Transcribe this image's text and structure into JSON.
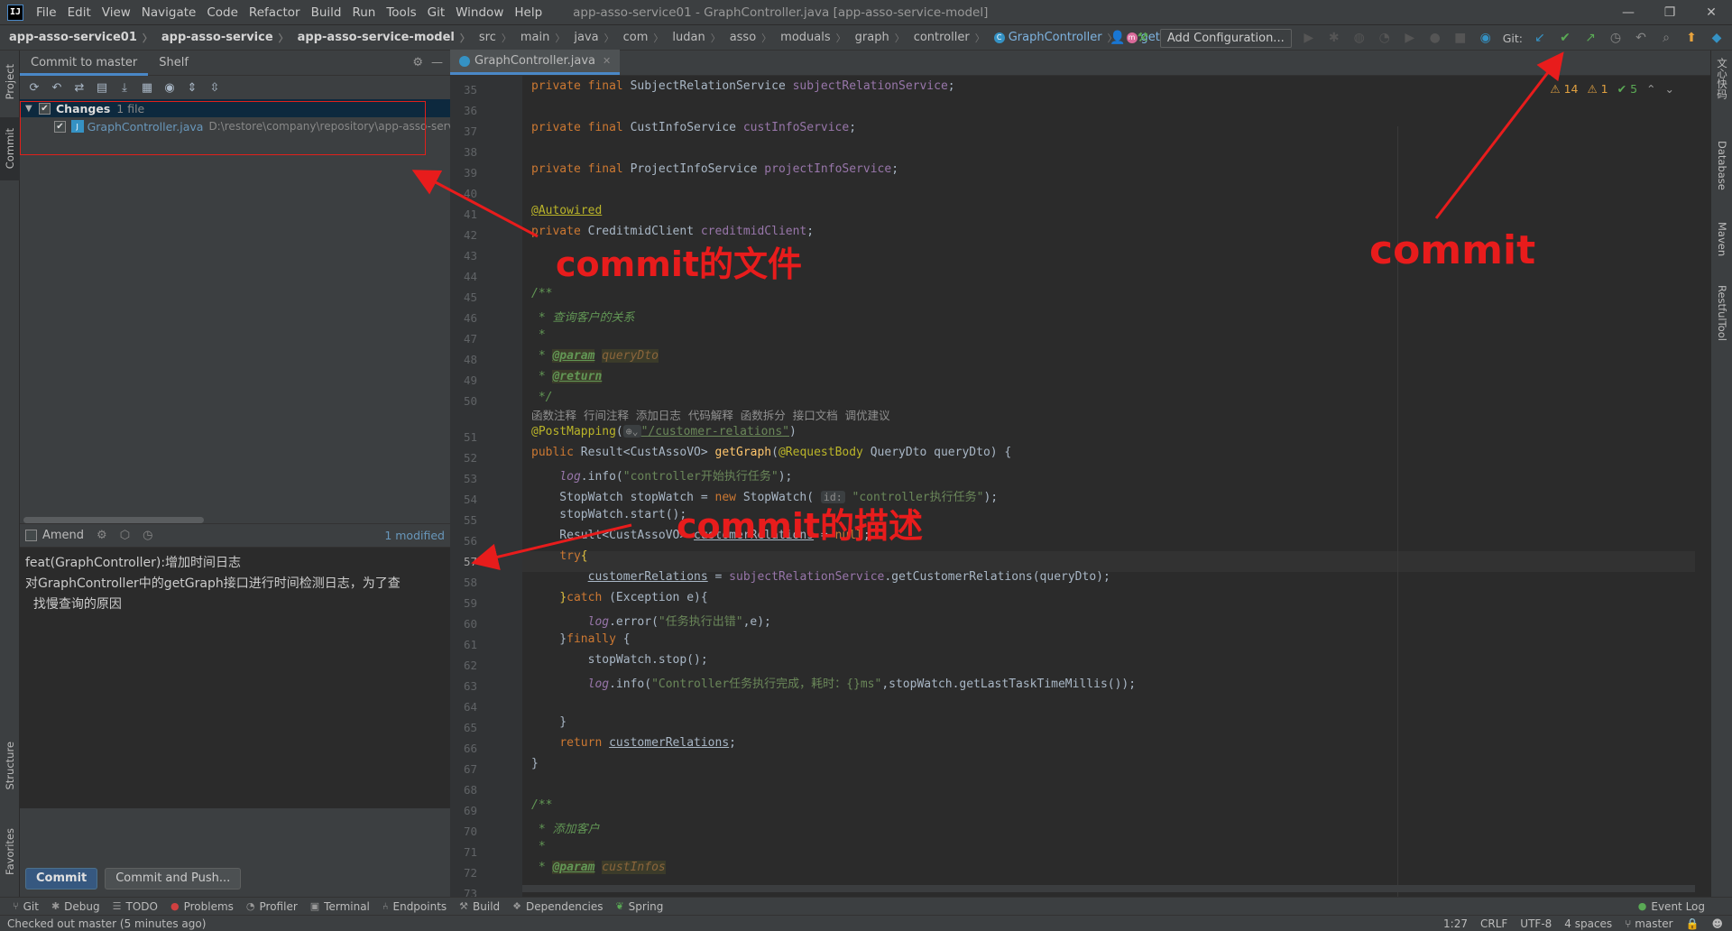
{
  "menu": {
    "items": [
      "File",
      "Edit",
      "View",
      "Navigate",
      "Code",
      "Refactor",
      "Build",
      "Run",
      "Tools",
      "Git",
      "Window",
      "Help"
    ],
    "window_title": "app-asso-service01 - GraphController.java [app-asso-service-model]"
  },
  "nav": {
    "breadcrumbs": [
      "app-asso-service01",
      "app-asso-service",
      "app-asso-service-model",
      "src",
      "main",
      "java",
      "com",
      "ludan",
      "asso",
      "moduals",
      "graph",
      "controller",
      "GraphController",
      "getGraph"
    ],
    "add_config": "Add Configuration...",
    "git_label": "Git:"
  },
  "left_tabs": {
    "project": "Project",
    "commit": "Commit",
    "structure": "Structure",
    "favorites": "Favorites"
  },
  "commit_panel": {
    "tab_commit": "Commit to master",
    "tab_shelf": "Shelf",
    "changes_label": "Changes",
    "changes_count": "1 file",
    "file_name": "GraphController.java",
    "file_path": "D:\\restore\\company\\repository\\app-asso-serv",
    "amend_label": "Amend",
    "modified": "1 modified",
    "message_lines": [
      "feat(GraphController):增加时间日志",
      "对GraphController中的getGraph接口进行时间检测日志，为了查",
      "  找慢查询的原因"
    ],
    "commit_button": "Commit",
    "commit_push_button": "Commit and Push..."
  },
  "editor": {
    "tab": "GraphController.java",
    "inspections": {
      "warnings": "14",
      "weak": "1",
      "ok": "5"
    },
    "line_numbers": [
      "35",
      "36",
      "37",
      "38",
      "39",
      "40",
      "41",
      "42",
      "43",
      "44",
      "45",
      "46",
      "47",
      "48",
      "49",
      "50",
      "51",
      "52",
      "53",
      "54",
      "55",
      "56",
      "57",
      "58",
      "59",
      "60",
      "61",
      "62",
      "63",
      "64",
      "65",
      "66",
      "67",
      "68",
      "69",
      "70",
      "71",
      "72",
      "73"
    ],
    "code_vision": "函数注释  行间注释  添加日志  代码解释  函数拆分  接口文档  调优建议"
  },
  "right_tabs": {
    "t1": "文心快码",
    "database": "Database",
    "maven": "Maven",
    "restful": "RestfulTool"
  },
  "toolwindows": [
    "Git",
    "Debug",
    "TODO",
    "Problems",
    "Profiler",
    "Terminal",
    "Endpoints",
    "Build",
    "Dependencies",
    "Spring"
  ],
  "event_log": "Event Log",
  "status": {
    "left": "Checked out master (5 minutes ago)",
    "position": "1:27",
    "line_sep": "CRLF",
    "encoding": "UTF-8",
    "indent": "4 spaces",
    "branch": "master"
  },
  "annotations": {
    "files": "commit的文件",
    "desc": "commit的描述",
    "commit": "commit"
  },
  "colors": {
    "annotation_red": "#e81c1c",
    "accent": "#4a88c7"
  }
}
